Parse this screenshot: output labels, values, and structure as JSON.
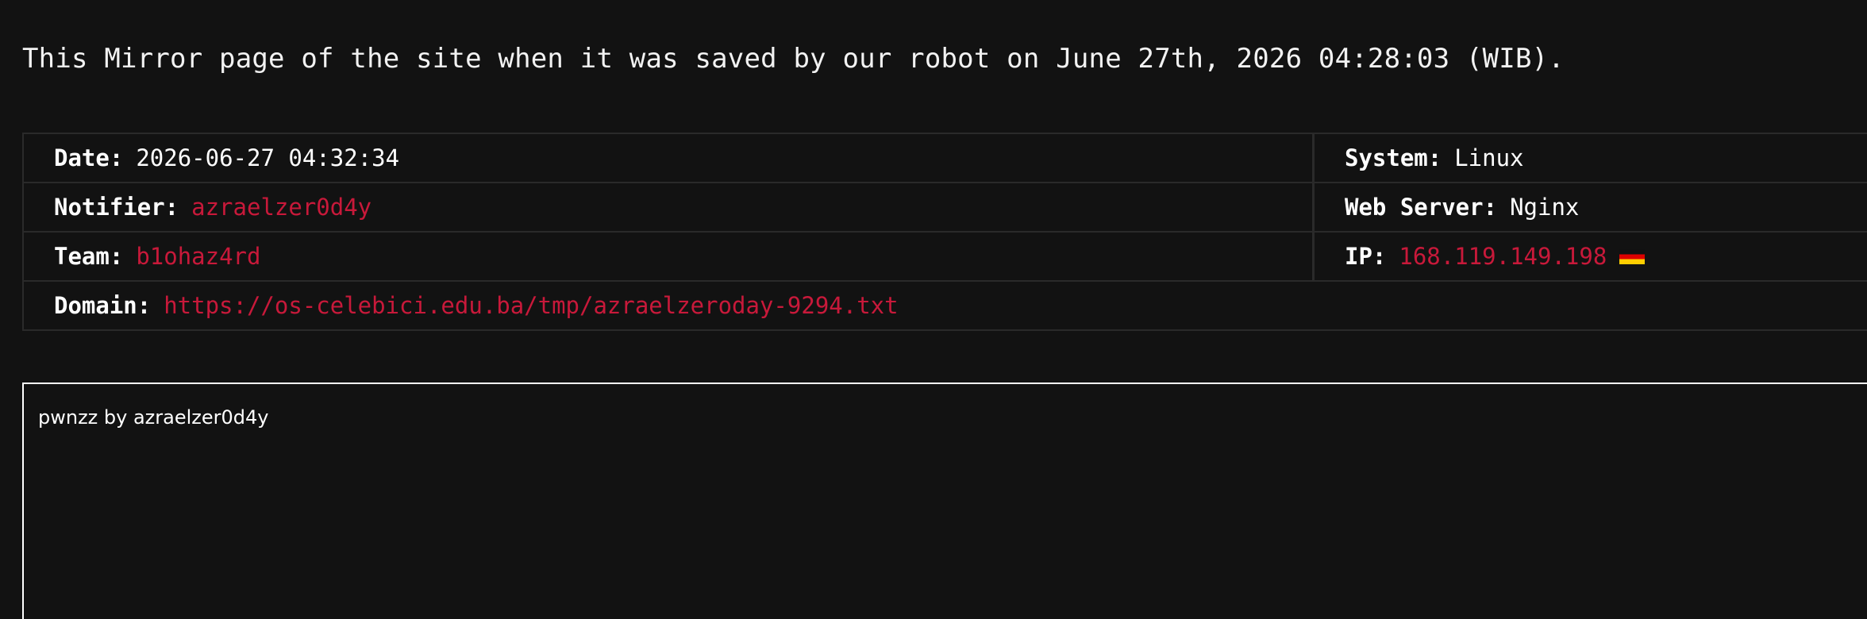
{
  "header": {
    "text": "This Mirror page of the site when it was saved by our robot on June 27th, 2026 04:28:03 (WIB)."
  },
  "info": {
    "date_label": "Date:",
    "date_value": "2026-06-27 04:32:34",
    "system_label": "System:",
    "system_value": "Linux",
    "notifier_label": "Notifier:",
    "notifier_value": "azraelzer0d4y",
    "webserver_label": "Web Server:",
    "webserver_value": "Nginx",
    "team_label": "Team:",
    "team_value": "b1ohaz4rd",
    "ip_label": "IP:",
    "ip_value": "168.119.149.198",
    "ip_flag_icon": "germany-flag-icon",
    "domain_label": "Domain:",
    "domain_value": "https://os-celebici.edu.ba/tmp/azraelzeroday-9294.txt"
  },
  "mirror": {
    "content": "pwnzz by azraelzer0d4y"
  },
  "colors": {
    "background": "#121212",
    "link": "#c8193a",
    "border": "#2a2a2a"
  }
}
